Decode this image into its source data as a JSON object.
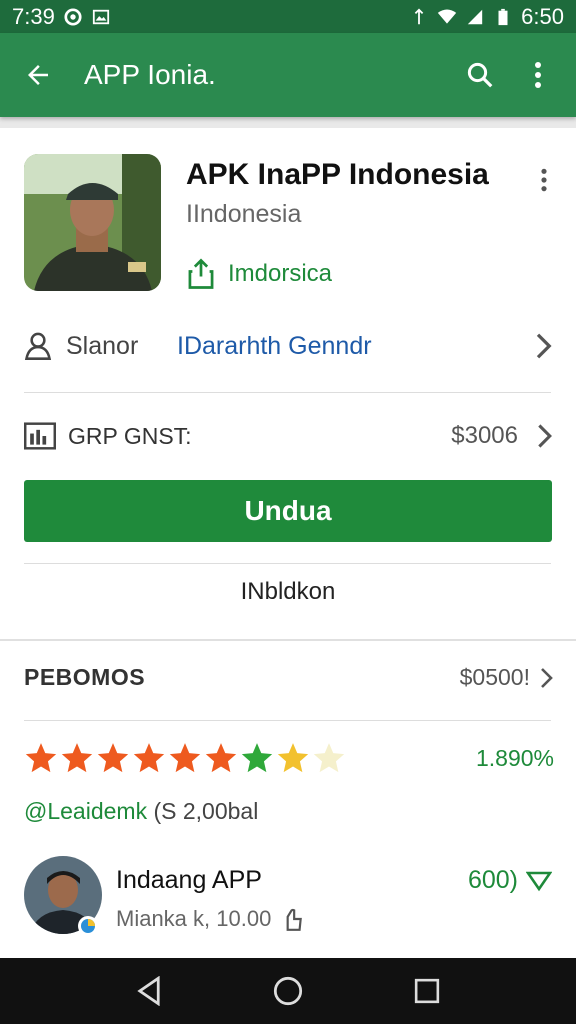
{
  "status_bar": {
    "time_left": "7:39",
    "time_right": "6:50",
    "icons_left": [
      "circle-icon",
      "image-icon"
    ],
    "icons_right": [
      "signal-icon",
      "wifi-icon",
      "cell-icon",
      "battery-icon"
    ]
  },
  "app_bar": {
    "title": "APP Ionia.",
    "back_icon": "arrow-left-icon",
    "search_icon": "search-icon",
    "menu_icon": "more-vert-icon"
  },
  "app": {
    "title": "APK InaPP Indonesia",
    "subtitle": "IIndonesia",
    "share_label": "Imdorsica"
  },
  "developer": {
    "label": "Slanor",
    "link": "IDararhth Genndr"
  },
  "price": {
    "label": "GRP GNST:",
    "value": "$3006"
  },
  "install_button": "Undua",
  "secondary_action": "INbldkon",
  "reviews": {
    "header": "PEBOMOS",
    "header_value": "$0500!",
    "rating_pct": "1.890%",
    "rating_sub_green": "@Leaidemk",
    "rating_sub_rest": "(S 2,00bal",
    "stars": [
      "#ee5a1f",
      "#ee5a1f",
      "#ee5a1f",
      "#ee5a1f",
      "#ee5a1f",
      "#ee5a1f",
      "#2fa83a",
      "#f2c12e",
      "#f5f0cc"
    ]
  },
  "review_item": {
    "name": "Indaang APP",
    "meta": "Mianka k, 10.00",
    "count": "600)"
  },
  "colors": {
    "status_bar": "#1e6b3c",
    "app_bar": "#2b8a4f",
    "install": "#1f8a3b",
    "accent_green": "#1e8a3a",
    "link_blue": "#1e5aa8"
  }
}
